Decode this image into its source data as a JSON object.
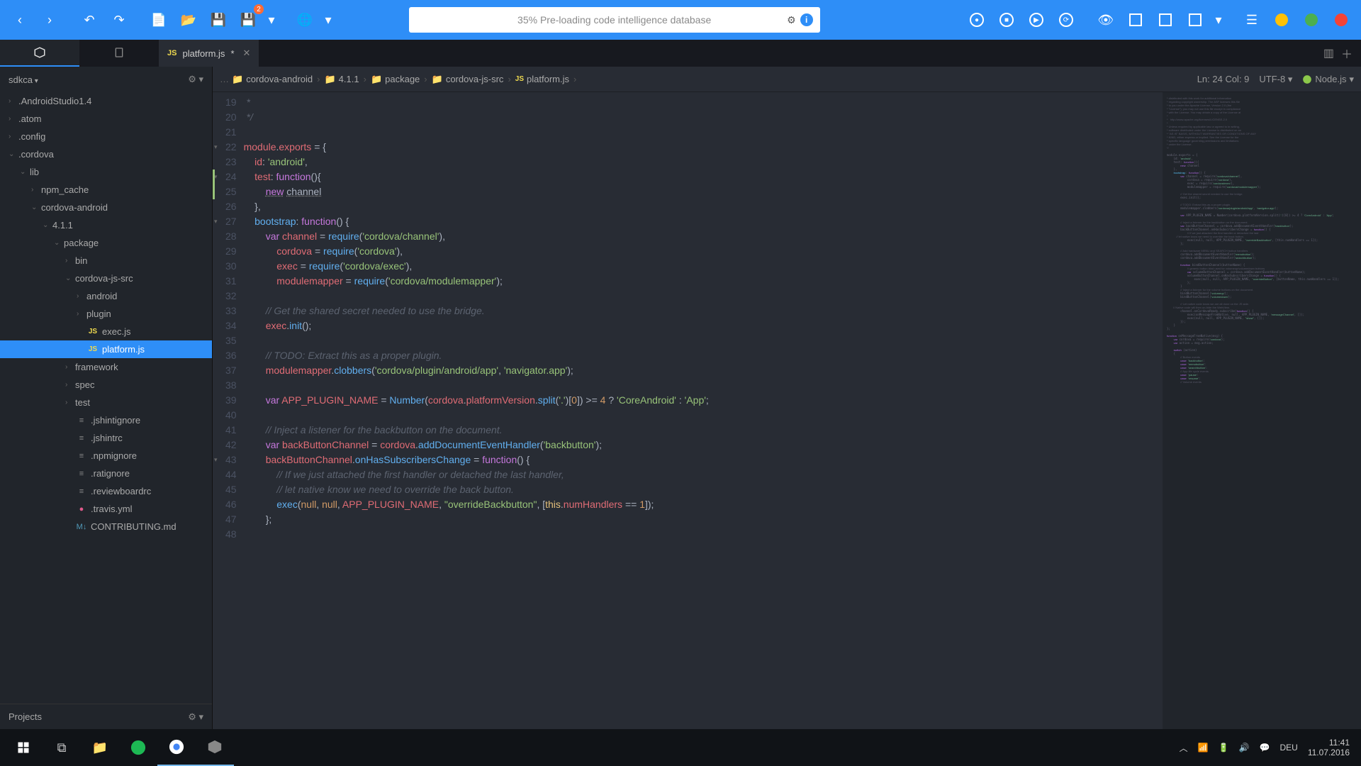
{
  "toolbar": {
    "status_text": "35% Pre-loading code intelligence database"
  },
  "tabs": {
    "file_name": "platform.js",
    "modified_indicator": "*"
  },
  "sidebar": {
    "root_label": "sdkca",
    "footer_label": "Projects",
    "items": [
      {
        "label": ".AndroidStudio1.4",
        "depth": 0,
        "chev": "›",
        "type": "folder"
      },
      {
        "label": ".atom",
        "depth": 0,
        "chev": "›",
        "type": "folder"
      },
      {
        "label": ".config",
        "depth": 0,
        "chev": "›",
        "type": "folder"
      },
      {
        "label": ".cordova",
        "depth": 0,
        "chev": "⌄",
        "type": "folder"
      },
      {
        "label": "lib",
        "depth": 1,
        "chev": "⌄",
        "type": "folder"
      },
      {
        "label": "npm_cache",
        "depth": 2,
        "chev": "›",
        "type": "folder"
      },
      {
        "label": "cordova-android",
        "depth": 2,
        "chev": "⌄",
        "type": "folder"
      },
      {
        "label": "4.1.1",
        "depth": 3,
        "chev": "⌄",
        "type": "folder"
      },
      {
        "label": "package",
        "depth": 4,
        "chev": "⌄",
        "type": "folder"
      },
      {
        "label": "bin",
        "depth": 5,
        "chev": "›",
        "type": "folder"
      },
      {
        "label": "cordova-js-src",
        "depth": 5,
        "chev": "⌄",
        "type": "folder"
      },
      {
        "label": "android",
        "depth": 6,
        "chev": "›",
        "type": "folder"
      },
      {
        "label": "plugin",
        "depth": 6,
        "chev": "›",
        "type": "folder"
      },
      {
        "label": "exec.js",
        "depth": 6,
        "chev": "",
        "type": "js"
      },
      {
        "label": "platform.js",
        "depth": 6,
        "chev": "",
        "type": "js",
        "selected": true
      },
      {
        "label": "framework",
        "depth": 5,
        "chev": "›",
        "type": "folder"
      },
      {
        "label": "spec",
        "depth": 5,
        "chev": "›",
        "type": "folder"
      },
      {
        "label": "test",
        "depth": 5,
        "chev": "›",
        "type": "folder"
      },
      {
        "label": ".jshintignore",
        "depth": 5,
        "chev": "",
        "type": "file"
      },
      {
        "label": ".jshintrc",
        "depth": 5,
        "chev": "",
        "type": "file"
      },
      {
        "label": ".npmignore",
        "depth": 5,
        "chev": "",
        "type": "file"
      },
      {
        "label": ".ratignore",
        "depth": 5,
        "chev": "",
        "type": "file"
      },
      {
        "label": ".reviewboardrc",
        "depth": 5,
        "chev": "",
        "type": "file"
      },
      {
        "label": ".travis.yml",
        "depth": 5,
        "chev": "",
        "type": "yml"
      },
      {
        "label": "CONTRIBUTING.md",
        "depth": 5,
        "chev": "",
        "type": "md"
      }
    ]
  },
  "breadcrumbs": {
    "items": [
      "cordova-android",
      "4.1.1",
      "package",
      "cordova-js-src",
      "platform.js"
    ]
  },
  "status": {
    "position": "Ln: 24 Col: 9",
    "encoding": "UTF-8",
    "language": "Node.js"
  },
  "editor": {
    "first_line": 19,
    "cursor_line": 24,
    "lines": [
      {
        "n": 19,
        "html": "<span class='cmt'> *</span>"
      },
      {
        "n": 20,
        "html": "<span class='cmt'> */</span>"
      },
      {
        "n": 21,
        "html": ""
      },
      {
        "n": 22,
        "fold": "▾",
        "html": "<span class='prop'>module</span>.<span class='prop'>exports</span> <span class='op'>=</span> {"
      },
      {
        "n": 23,
        "html": "    <span class='prop'>id</span>: <span class='str'>'android'</span>,"
      },
      {
        "n": 24,
        "fold": "▾",
        "html": "    <span class='prop'>test</span>: <span class='kw'>function</span>(){",
        "cursor": true
      },
      {
        "n": 25,
        "html": "        <span class='kw underline-dotted'>new</span> <span class='underline-dotted'>channel</span>"
      },
      {
        "n": 26,
        "html": "    },"
      },
      {
        "n": 27,
        "fold": "▾",
        "html": "    <span class='fn'>bootstrap</span>: <span class='kw'>function</span>() {"
      },
      {
        "n": 28,
        "html": "        <span class='kw'>var</span> <span class='prop'>channel</span> <span class='op'>=</span> <span class='fn'>require</span>(<span class='str'>'cordova/channel'</span>),"
      },
      {
        "n": 29,
        "html": "            <span class='prop'>cordova</span> <span class='op'>=</span> <span class='fn'>require</span>(<span class='str'>'cordova'</span>),"
      },
      {
        "n": 30,
        "html": "            <span class='prop'>exec</span> <span class='op'>=</span> <span class='fn'>require</span>(<span class='str'>'cordova/exec'</span>),"
      },
      {
        "n": 31,
        "html": "            <span class='prop'>modulemapper</span> <span class='op'>=</span> <span class='fn'>require</span>(<span class='str'>'cordova/modulemapper'</span>);"
      },
      {
        "n": 32,
        "html": ""
      },
      {
        "n": 33,
        "html": "        <span class='cmt'>// Get the shared secret needed to use the bridge.</span>"
      },
      {
        "n": 34,
        "html": "        <span class='prop'>exec</span>.<span class='fn'>init</span>();"
      },
      {
        "n": 35,
        "html": ""
      },
      {
        "n": 36,
        "html": "        <span class='cmt'>// TODO: Extract this as a proper plugin.</span>"
      },
      {
        "n": 37,
        "html": "        <span class='prop'>modulemapper</span>.<span class='fn'>clobbers</span>(<span class='str'>'cordova/plugin/android/app'</span>, <span class='str'>'navigator.app'</span>);"
      },
      {
        "n": 38,
        "html": ""
      },
      {
        "n": 39,
        "html": "        <span class='kw'>var</span> <span class='prop'>APP_PLUGIN_NAME</span> <span class='op'>=</span> <span class='fn'>Number</span>(<span class='prop'>cordova</span>.<span class='prop'>platformVersion</span>.<span class='fn'>split</span>(<span class='str'>'.'</span>)[<span class='num'>0</span>]) <span class='op'>&gt;=</span> <span class='num'>4</span> <span class='op'>?</span> <span class='str'>'CoreAndroid'</span> <span class='op'>:</span> <span class='str'>'App'</span>;"
      },
      {
        "n": 40,
        "html": ""
      },
      {
        "n": 41,
        "html": "        <span class='cmt'>// Inject a listener for the backbutton on the document.</span>"
      },
      {
        "n": 42,
        "html": "        <span class='kw'>var</span> <span class='prop'>backButtonChannel</span> <span class='op'>=</span> <span class='prop'>cordova</span>.<span class='fn'>addDocumentEventHandler</span>(<span class='str'>'backbutton'</span>);"
      },
      {
        "n": 43,
        "fold": "▾",
        "html": "        <span class='prop'>backButtonChannel</span>.<span class='fn'>onHasSubscribersChange</span> <span class='op'>=</span> <span class='kw'>function</span>() {"
      },
      {
        "n": 44,
        "html": "            <span class='cmt'>// If we just attached the first handler or detached the last handler,</span>"
      },
      {
        "n": 45,
        "html": "            <span class='cmt'>// let native know we need to override the back button.</span>"
      },
      {
        "n": 46,
        "html": "            <span class='fn'>exec</span>(<span class='num'>null</span>, <span class='num'>null</span>, <span class='prop'>APP_PLUGIN_NAME</span>, <span class='str'>\"overrideBackbutton\"</span>, [<span class='this'>this</span>.<span class='prop'>numHandlers</span> <span class='op'>==</span> <span class='num'>1</span>]);"
      },
      {
        "n": 47,
        "html": "        };"
      },
      {
        "n": 48,
        "html": ""
      }
    ]
  },
  "taskbar": {
    "lang": "DEU",
    "time": "11:41",
    "date": "11.07.2016"
  }
}
